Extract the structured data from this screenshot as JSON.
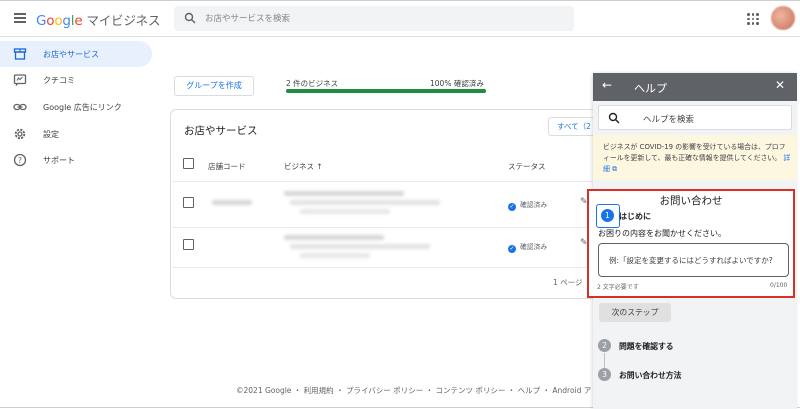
{
  "app": {
    "logo_letters": [
      "G",
      "o",
      "o",
      "g",
      "l",
      "e"
    ],
    "product_name": "マイビジネス"
  },
  "search": {
    "placeholder": "お店やサービスを検索"
  },
  "sidebar": {
    "items": [
      {
        "label": "お店やサービス",
        "icon": "storefront-icon",
        "active": true
      },
      {
        "label": "クチコミ",
        "icon": "reviews-icon",
        "active": false
      },
      {
        "label": "Google 広告にリンク",
        "icon": "link-icon",
        "active": false
      },
      {
        "label": "設定",
        "icon": "gear-icon",
        "active": false
      },
      {
        "label": "サポート",
        "icon": "help-circle-icon",
        "active": false
      }
    ]
  },
  "main": {
    "create_group_label": "グループを作成",
    "business_count": "2 件のビジネス",
    "verified_percent_label": "100% 確認済み",
    "verified_fraction": 1.0,
    "card_title": "お店やサービス",
    "filter_label": "すべて（2",
    "columns": {
      "store_code": "店舗コード",
      "business": "ビジネス ↑",
      "status": "ステータス"
    },
    "rows": [
      {
        "status": "確認済み"
      },
      {
        "status": "確認済み"
      }
    ],
    "pagination": "1 ページ"
  },
  "footer": {
    "text": "©2021 Google ・ 利用規約 ・ プライバシー ポリシー ・ コンテンツ ポリシー ・ ヘルプ ・ Android ア"
  },
  "help": {
    "title": "ヘルプ",
    "search_placeholder": "ヘルプを検索",
    "notice_text": "ビジネスが COVID-19 の影響を受けている場合は、プロフィールを更新して、最も正確な情報を提供してください。",
    "notice_link": "詳細",
    "contact_title": "お問い合わせ",
    "step1": {
      "number": "1",
      "label": "はじめに"
    },
    "prompt": "お困りの内容をお聞かせください。",
    "textarea_placeholder": "例:「設定を変更するにはどうすればよいですか?",
    "requirement": "2 文字必要です",
    "counter": "0/100",
    "next_label": "次のステップ",
    "step2": {
      "number": "2",
      "label": "問題を確認する"
    },
    "step3": {
      "number": "3",
      "label": "お問い合わせ方法"
    }
  },
  "colors": {
    "accent": "#1a73e8",
    "highlight_border": "#d93025",
    "progress": "#1e8e3e",
    "notice_bg": "#fef7e0"
  }
}
